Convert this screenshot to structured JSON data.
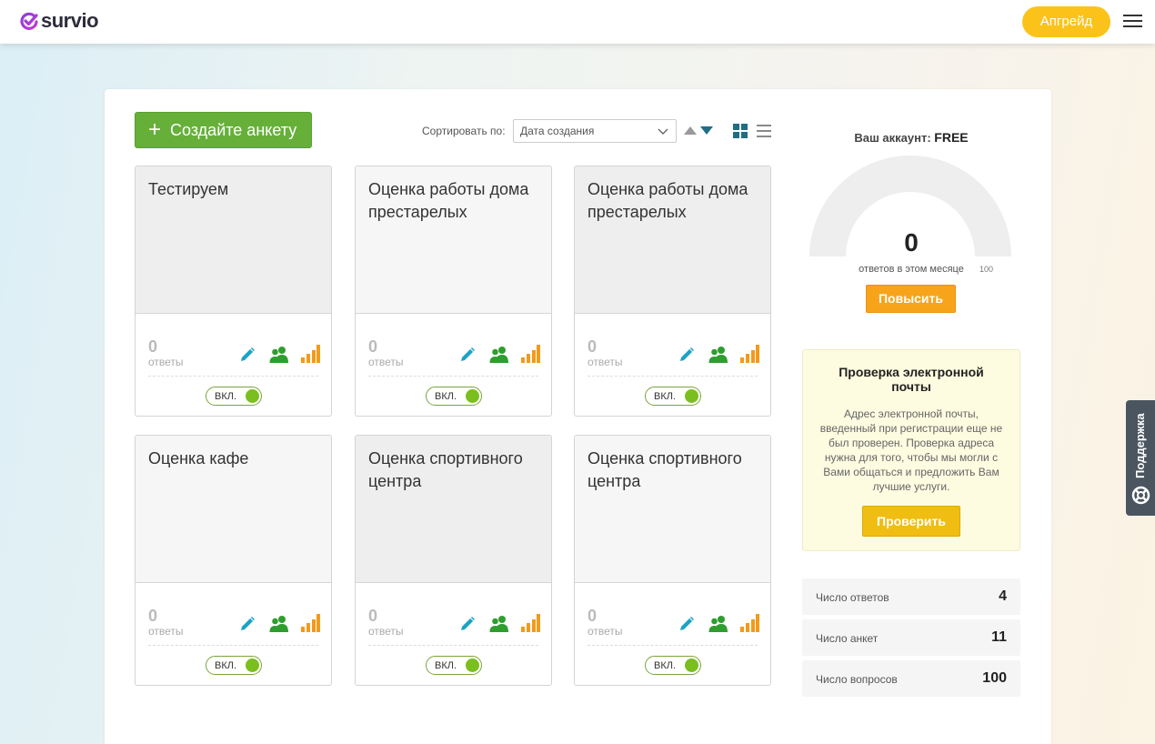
{
  "header": {
    "logo_text": "survio",
    "upgrade_label": "Апгрейд",
    "menu_icon": "hamburger-menu-icon"
  },
  "toolbar": {
    "create_label": "Создайте анкету",
    "sort_label": "Сортировать по:",
    "sort_value": "Дата создания"
  },
  "surveys": [
    {
      "title": "Тестируем",
      "count": "0",
      "count_label": "ответы",
      "toggle_label": "ВКЛ."
    },
    {
      "title": "Оценка работы дома престарелых",
      "count": "0",
      "count_label": "ответы",
      "toggle_label": "ВКЛ."
    },
    {
      "title": "Оценка работы дома престарелых",
      "count": "0",
      "count_label": "ответы",
      "toggle_label": "ВКЛ."
    },
    {
      "title": "Оценка кафе",
      "count": "0",
      "count_label": "ответы",
      "toggle_label": "ВКЛ."
    },
    {
      "title": "Оценка спортивного центра",
      "count": "0",
      "count_label": "ответы",
      "toggle_label": "ВКЛ."
    },
    {
      "title": "Оценка спортивного центра",
      "count": "0",
      "count_label": "ответы",
      "toggle_label": "ВКЛ."
    }
  ],
  "account": {
    "label": "Ваш аккаунт:",
    "plan": "FREE",
    "responses_value": "0",
    "responses_label": "ответов в этом месяце",
    "responses_max": "100",
    "raise_label": "Повысить"
  },
  "email_check": {
    "title": "Проверка электронной почты",
    "text": "Адрес электронной почты, введенный при регистрации еще не был проверен. Проверка адреса нужна для того, чтобы мы могли с Вами общаться и предложить Вам лучшие услуги.",
    "button_label": "Проверить"
  },
  "stats": [
    {
      "name": "Число ответов",
      "value": "4"
    },
    {
      "name": "Число анкет",
      "value": "11"
    },
    {
      "name": "Число вопросов",
      "value": "100"
    }
  ],
  "support_label": "Поддержка",
  "colors": {
    "brand_green": "#66b03a",
    "upgrade_yellow": "#fbc319",
    "raise_orange": "#f7a41b",
    "edit_teal": "#1ba3c4",
    "users_green": "#2e9e2e",
    "stats_orange": "#f39a1b"
  }
}
